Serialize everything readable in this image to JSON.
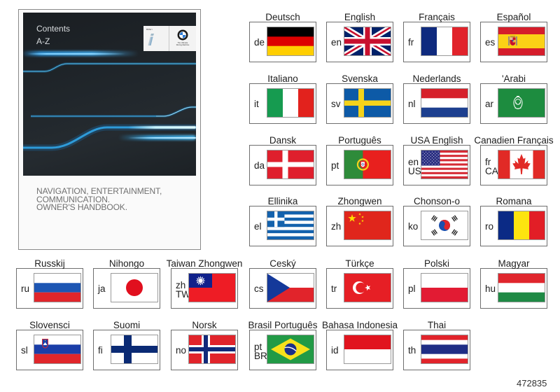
{
  "cover": {
    "title": "Contents",
    "subtitle": "A-Z",
    "logos": {
      "bmw_i_label": "BMW i",
      "bmw_tagline_lines": [
        "The Ultimate",
        "Driving Machine"
      ]
    },
    "description_lines": [
      "NAVIGATION, ENTERTAINMENT,",
      "COMMUNICATION.",
      "OWNER'S HANDBOOK."
    ]
  },
  "languages": [
    {
      "name": "Deutsch",
      "code": [
        "de"
      ],
      "flag": "germany"
    },
    {
      "name": "English",
      "code": [
        "en"
      ],
      "flag": "united-kingdom"
    },
    {
      "name": "Français",
      "code": [
        "fr"
      ],
      "flag": "france"
    },
    {
      "name": "Español",
      "code": [
        "es"
      ],
      "flag": "spain"
    },
    {
      "name": "Italiano",
      "code": [
        "it"
      ],
      "flag": "italy"
    },
    {
      "name": "Svenska",
      "code": [
        "sv"
      ],
      "flag": "sweden"
    },
    {
      "name": "Nederlands",
      "code": [
        "nl"
      ],
      "flag": "netherlands"
    },
    {
      "name": "'Arabi",
      "code": [
        "ar"
      ],
      "flag": "arab-league"
    },
    {
      "name": "Dansk",
      "code": [
        "da"
      ],
      "flag": "denmark"
    },
    {
      "name": "Português",
      "code": [
        "pt"
      ],
      "flag": "portugal"
    },
    {
      "name": "USA English",
      "code": [
        "en",
        "US"
      ],
      "flag": "united-states"
    },
    {
      "name": "Canadien Français",
      "code": [
        "fr",
        "CA"
      ],
      "flag": "canada"
    },
    {
      "name": "Ellinika",
      "code": [
        "el"
      ],
      "flag": "greece"
    },
    {
      "name": "Zhongwen",
      "code": [
        "zh"
      ],
      "flag": "china"
    },
    {
      "name": "Chonson-o",
      "code": [
        "ko"
      ],
      "flag": "south-korea"
    },
    {
      "name": "Romana",
      "code": [
        "ro"
      ],
      "flag": "romania"
    },
    {
      "name": "Russkij",
      "code": [
        "ru"
      ],
      "flag": "russia"
    },
    {
      "name": "Nihongo",
      "code": [
        "ja"
      ],
      "flag": "japan"
    },
    {
      "name": "Taiwan Zhongwen",
      "code": [
        "zh",
        "TW"
      ],
      "flag": "taiwan"
    },
    {
      "name": "Ceský",
      "code": [
        "cs"
      ],
      "flag": "czech-republic"
    },
    {
      "name": "Türkçe",
      "code": [
        "tr"
      ],
      "flag": "turkey"
    },
    {
      "name": "Polski",
      "code": [
        "pl"
      ],
      "flag": "poland"
    },
    {
      "name": "Magyar",
      "code": [
        "hu"
      ],
      "flag": "hungary"
    },
    {
      "name": "Slovensci",
      "code": [
        "sl"
      ],
      "flag": "slovenia"
    },
    {
      "name": "Suomi",
      "code": [
        "fi"
      ],
      "flag": "finland"
    },
    {
      "name": "Norsk",
      "code": [
        "no"
      ],
      "flag": "norway"
    },
    {
      "name": "Brasil Português",
      "code": [
        "pt",
        "BR"
      ],
      "flag": "brazil"
    },
    {
      "name": "Bahasa Indonesia",
      "code": [
        "id"
      ],
      "flag": "indonesia"
    },
    {
      "name": "Thai",
      "code": [
        "th"
      ],
      "flag": "thailand"
    }
  ],
  "illustration_number": "472835"
}
